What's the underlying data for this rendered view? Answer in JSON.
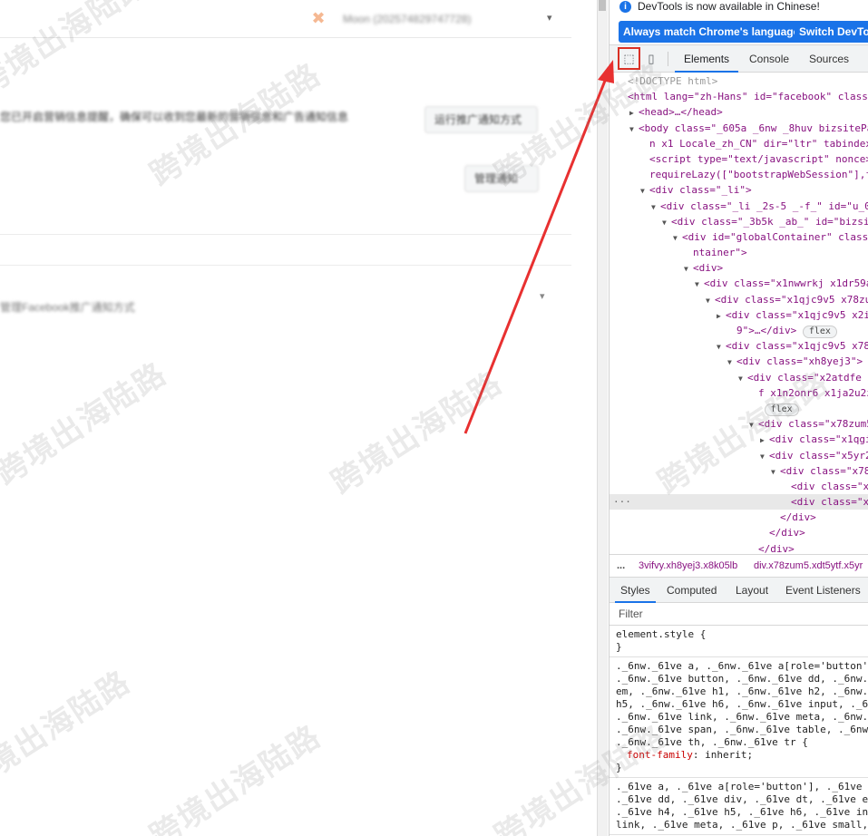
{
  "page": {
    "account_label": "Moon (202574829747728)",
    "info_text": "您已开启营销信息提醒，确保可以收到您最新的营销信息和广告通知信息",
    "button1": "运行推广通知方式",
    "button2": "管理通知",
    "row_text": "管理Facebook推广通知方式"
  },
  "devtools": {
    "banner_text": "DevTools is now available in Chinese!",
    "btn_match": "Always match Chrome's language",
    "btn_switch": "Switch DevTools",
    "tabs": [
      "Elements",
      "Console",
      "Sources"
    ],
    "dom_lines": [
      {
        "indent": 0,
        "tri": "",
        "text": "<!DOCTYPE html>"
      },
      {
        "indent": 0,
        "tri": "",
        "text": "<html lang=\"zh-Hans\" id=\"facebook\" class=\""
      },
      {
        "indent": 1,
        "tri": "▶",
        "text": "<head>…</head>"
      },
      {
        "indent": 1,
        "tri": "▼",
        "text": "<body class=\"_605a _6nw _8huv bizsitePa"
      },
      {
        "indent": 2,
        "tri": "",
        "text": "n x1 Locale_zh_CN\" dir=\"ltr\" tabindex=\""
      },
      {
        "indent": 2,
        "tri": "",
        "text": "<script type=\"text/javascript\" nonce>"
      },
      {
        "indent": 2,
        "tri": "",
        "text": "requireLazy([\"bootstrapWebSession\"],f"
      },
      {
        "indent": 2,
        "tri": "▼",
        "text": "<div class=\"_li\">"
      },
      {
        "indent": 3,
        "tri": "▼",
        "text": "<div class=\"_li _2s-5 _-f_\" id=\"u_0_"
      },
      {
        "indent": 4,
        "tri": "▼",
        "text": "<div class=\"_3b5k _ab_\" id=\"bizsit"
      },
      {
        "indent": 5,
        "tri": "▼",
        "text": "<div id=\"globalContainer\" class="
      },
      {
        "indent": 6,
        "tri": "",
        "text": "ntainer\">"
      },
      {
        "indent": 6,
        "tri": "▼",
        "text": "<div>"
      },
      {
        "indent": 7,
        "tri": "▼",
        "text": "<div class=\"x1nwwrkj x1dr59a"
      },
      {
        "indent": 8,
        "tri": "▼",
        "text": "<div class=\"x1qjc9v5 x78zum"
      },
      {
        "indent": 9,
        "tri": "▶",
        "text": "<div class=\"x1qjc9v5 x2i"
      },
      {
        "indent": 10,
        "tri": "",
        "text": "9\">…</div>",
        "pill": "flex"
      },
      {
        "indent": 9,
        "tri": "▼",
        "text": "<div class=\"x1qjc9v5 x78"
      },
      {
        "indent": 10,
        "tri": "▼",
        "text": "<div class=\"xh8yej3\">"
      },
      {
        "indent": 11,
        "tri": "▼",
        "text": "<div class=\"x2atdfe x"
      },
      {
        "indent": 12,
        "tri": "",
        "text": "f x1n2onr6 x1ja2u2z x"
      },
      {
        "indent": 12,
        "tri": "",
        "text": "",
        "pill": "flex"
      },
      {
        "indent": 12,
        "tri": "▼",
        "text": "<div class=\"x78zum5"
      },
      {
        "indent": 13,
        "tri": "▶",
        "text": "<div class=\"x1qgi"
      },
      {
        "indent": 13,
        "tri": "▼",
        "text": "<div class=\"x5yr2"
      },
      {
        "indent": 14,
        "tri": "▼",
        "text": "<div class=\"x78"
      },
      {
        "indent": 15,
        "tri": "",
        "text": "<div class=\"xh"
      },
      {
        "indent": 15,
        "tri": "",
        "text": "<div class=\"x5",
        "sel": true
      },
      {
        "indent": 14,
        "tri": "",
        "text": "</div>"
      },
      {
        "indent": 13,
        "tri": "",
        "text": "</div>"
      },
      {
        "indent": 12,
        "tri": "",
        "text": "</div>"
      }
    ],
    "breadcrumb1": "3vifvy.xh8yej3.x8k05lb",
    "breadcrumb2": "div.x78zum5.xdt5ytf.x5yr",
    "styles_tabs": [
      "Styles",
      "Computed",
      "Layout",
      "Event Listeners"
    ],
    "filter_label": "Filter",
    "rule1_lines": [
      "element.style {",
      "}"
    ],
    "rule2_lines": [
      "._6nw._61ve a, ._6nw._61ve a[role='button'",
      "._6nw._61ve button, ._6nw._61ve dd, ._6nw._",
      "em, ._6nw._61ve h1, ._6nw._61ve h2, ._6nw.",
      "h5, ._6nw._61ve h6, ._6nw._61ve input, ._6n",
      "._6nw._61ve link, ._6nw._61ve meta, ._6nw._",
      "._6nw._61ve span, ._6nw._61ve table, ._6nw",
      "._6nw._61ve th, ._6nw._61ve tr {"
    ],
    "rule2_prop": "font-family",
    "rule2_val": "inherit;",
    "rule3_lines": [
      "._61ve a, ._61ve a[role='button'], ._61ve b",
      "._61ve dd, ._61ve div, ._61ve dt, ._61ve em",
      "._61ve h4, ._61ve h5, ._61ve h6, ._61ve inp",
      "link, ._61ve meta, ._61ve p, ._61ve small,"
    ]
  },
  "watermark": "跨境出海陆路",
  "colors": {
    "accent": "#1a73e8",
    "highlight": "#d93025",
    "arrow": "#e83030"
  }
}
